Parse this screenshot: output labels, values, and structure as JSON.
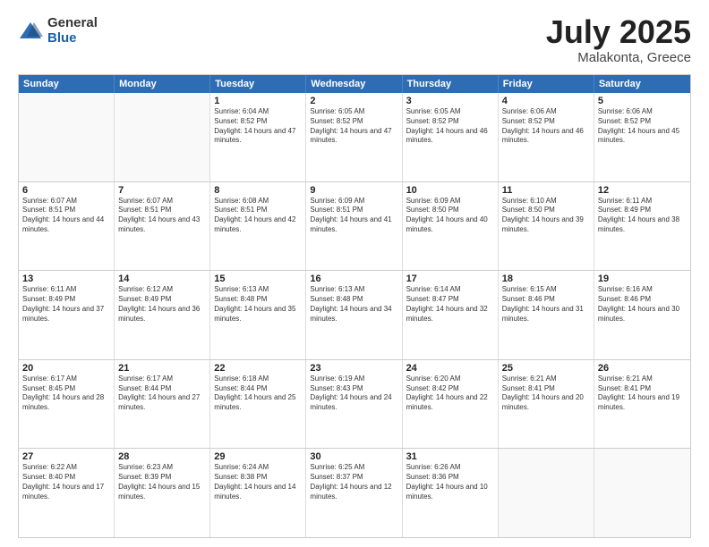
{
  "logo": {
    "general": "General",
    "blue": "Blue"
  },
  "title": {
    "month": "July 2025",
    "location": "Malakonta, Greece"
  },
  "header_days": [
    "Sunday",
    "Monday",
    "Tuesday",
    "Wednesday",
    "Thursday",
    "Friday",
    "Saturday"
  ],
  "weeks": [
    [
      {
        "day": "",
        "info": "",
        "empty": true
      },
      {
        "day": "",
        "info": "",
        "empty": true
      },
      {
        "day": "1",
        "info": "Sunrise: 6:04 AM\nSunset: 8:52 PM\nDaylight: 14 hours and 47 minutes."
      },
      {
        "day": "2",
        "info": "Sunrise: 6:05 AM\nSunset: 8:52 PM\nDaylight: 14 hours and 47 minutes."
      },
      {
        "day": "3",
        "info": "Sunrise: 6:05 AM\nSunset: 8:52 PM\nDaylight: 14 hours and 46 minutes."
      },
      {
        "day": "4",
        "info": "Sunrise: 6:06 AM\nSunset: 8:52 PM\nDaylight: 14 hours and 46 minutes."
      },
      {
        "day": "5",
        "info": "Sunrise: 6:06 AM\nSunset: 8:52 PM\nDaylight: 14 hours and 45 minutes."
      }
    ],
    [
      {
        "day": "6",
        "info": "Sunrise: 6:07 AM\nSunset: 8:51 PM\nDaylight: 14 hours and 44 minutes."
      },
      {
        "day": "7",
        "info": "Sunrise: 6:07 AM\nSunset: 8:51 PM\nDaylight: 14 hours and 43 minutes."
      },
      {
        "day": "8",
        "info": "Sunrise: 6:08 AM\nSunset: 8:51 PM\nDaylight: 14 hours and 42 minutes."
      },
      {
        "day": "9",
        "info": "Sunrise: 6:09 AM\nSunset: 8:51 PM\nDaylight: 14 hours and 41 minutes."
      },
      {
        "day": "10",
        "info": "Sunrise: 6:09 AM\nSunset: 8:50 PM\nDaylight: 14 hours and 40 minutes."
      },
      {
        "day": "11",
        "info": "Sunrise: 6:10 AM\nSunset: 8:50 PM\nDaylight: 14 hours and 39 minutes."
      },
      {
        "day": "12",
        "info": "Sunrise: 6:11 AM\nSunset: 8:49 PM\nDaylight: 14 hours and 38 minutes."
      }
    ],
    [
      {
        "day": "13",
        "info": "Sunrise: 6:11 AM\nSunset: 8:49 PM\nDaylight: 14 hours and 37 minutes."
      },
      {
        "day": "14",
        "info": "Sunrise: 6:12 AM\nSunset: 8:49 PM\nDaylight: 14 hours and 36 minutes."
      },
      {
        "day": "15",
        "info": "Sunrise: 6:13 AM\nSunset: 8:48 PM\nDaylight: 14 hours and 35 minutes."
      },
      {
        "day": "16",
        "info": "Sunrise: 6:13 AM\nSunset: 8:48 PM\nDaylight: 14 hours and 34 minutes."
      },
      {
        "day": "17",
        "info": "Sunrise: 6:14 AM\nSunset: 8:47 PM\nDaylight: 14 hours and 32 minutes."
      },
      {
        "day": "18",
        "info": "Sunrise: 6:15 AM\nSunset: 8:46 PM\nDaylight: 14 hours and 31 minutes."
      },
      {
        "day": "19",
        "info": "Sunrise: 6:16 AM\nSunset: 8:46 PM\nDaylight: 14 hours and 30 minutes."
      }
    ],
    [
      {
        "day": "20",
        "info": "Sunrise: 6:17 AM\nSunset: 8:45 PM\nDaylight: 14 hours and 28 minutes."
      },
      {
        "day": "21",
        "info": "Sunrise: 6:17 AM\nSunset: 8:44 PM\nDaylight: 14 hours and 27 minutes."
      },
      {
        "day": "22",
        "info": "Sunrise: 6:18 AM\nSunset: 8:44 PM\nDaylight: 14 hours and 25 minutes."
      },
      {
        "day": "23",
        "info": "Sunrise: 6:19 AM\nSunset: 8:43 PM\nDaylight: 14 hours and 24 minutes."
      },
      {
        "day": "24",
        "info": "Sunrise: 6:20 AM\nSunset: 8:42 PM\nDaylight: 14 hours and 22 minutes."
      },
      {
        "day": "25",
        "info": "Sunrise: 6:21 AM\nSunset: 8:41 PM\nDaylight: 14 hours and 20 minutes."
      },
      {
        "day": "26",
        "info": "Sunrise: 6:21 AM\nSunset: 8:41 PM\nDaylight: 14 hours and 19 minutes."
      }
    ],
    [
      {
        "day": "27",
        "info": "Sunrise: 6:22 AM\nSunset: 8:40 PM\nDaylight: 14 hours and 17 minutes."
      },
      {
        "day": "28",
        "info": "Sunrise: 6:23 AM\nSunset: 8:39 PM\nDaylight: 14 hours and 15 minutes."
      },
      {
        "day": "29",
        "info": "Sunrise: 6:24 AM\nSunset: 8:38 PM\nDaylight: 14 hours and 14 minutes."
      },
      {
        "day": "30",
        "info": "Sunrise: 6:25 AM\nSunset: 8:37 PM\nDaylight: 14 hours and 12 minutes."
      },
      {
        "day": "31",
        "info": "Sunrise: 6:26 AM\nSunset: 8:36 PM\nDaylight: 14 hours and 10 minutes."
      },
      {
        "day": "",
        "info": "",
        "empty": true
      },
      {
        "day": "",
        "info": "",
        "empty": true
      }
    ]
  ]
}
